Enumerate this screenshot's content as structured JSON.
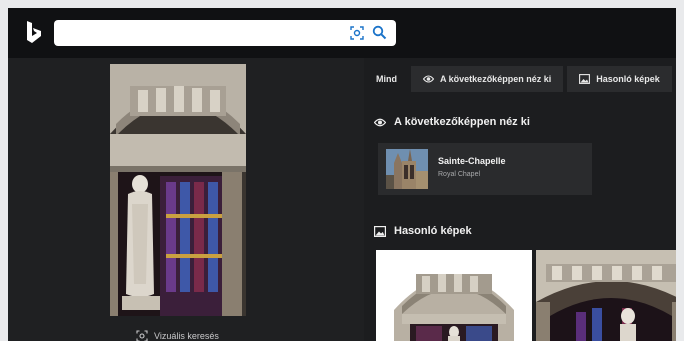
{
  "search": {
    "placeholder": "",
    "value": "",
    "icons": [
      "visual-search-icon",
      "search-icon"
    ]
  },
  "header": {
    "logo": "bing-logo"
  },
  "preview": {
    "image": "Sainte-Chapelle portal statue photo",
    "visual_search_label": "Vizuális keresés"
  },
  "tabs": [
    {
      "label": "Mind",
      "icon": "",
      "active": true
    },
    {
      "label": "A következőképpen néz ki",
      "icon": "eye-icon",
      "active": false
    },
    {
      "label": "Hasonló képek",
      "icon": "image-icon",
      "active": false
    }
  ],
  "looks_like": {
    "heading": "A következőképpen néz ki",
    "result": {
      "name": "Sainte-Chapelle",
      "description": "Royal Chapel"
    }
  },
  "similar": {
    "heading": "Hasonló képek"
  },
  "colors": {
    "topbar": "#101113",
    "panel": "#1f2022",
    "card": "#2a2b2d",
    "text": "#f0f0f0"
  }
}
